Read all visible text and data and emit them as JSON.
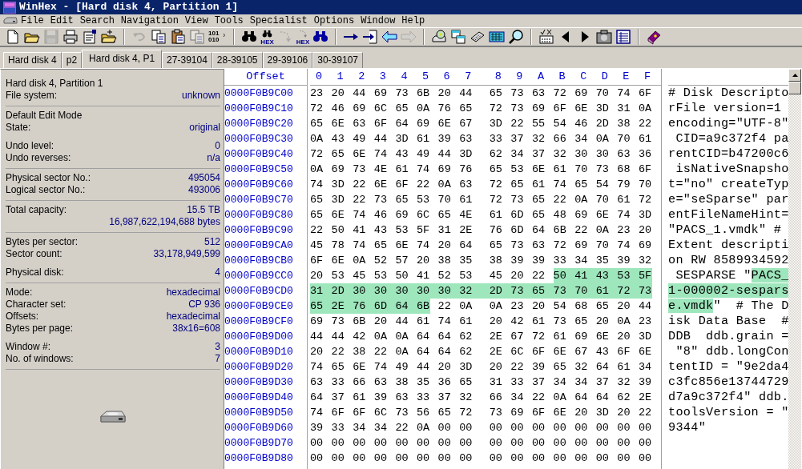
{
  "window": {
    "title": "WinHex - [Hard disk 4, Partition 1]"
  },
  "menu": [
    "File",
    "Edit",
    "Search",
    "Navigation",
    "View",
    "Tools",
    "Specialist",
    "Options",
    "Window",
    "Help"
  ],
  "toolbar": [
    [
      {
        "kind": "new",
        "disabled": false
      },
      {
        "kind": "open",
        "disabled": false
      },
      {
        "kind": "save",
        "disabled": true
      },
      {
        "kind": "print",
        "disabled": false
      },
      {
        "kind": "properties",
        "disabled": false
      },
      {
        "kind": "open-special",
        "disabled": false
      }
    ],
    [
      {
        "kind": "undo",
        "disabled": true
      },
      {
        "kind": "copy",
        "disabled": false
      },
      {
        "kind": "paste",
        "disabled": false
      },
      {
        "kind": "copy",
        "disabled": true
      },
      {
        "kind": "convert",
        "disabled": false,
        "caption": [
          "101",
          "010"
        ]
      }
    ],
    [
      {
        "kind": "find",
        "disabled": false
      },
      {
        "kind": "find",
        "disabled": false,
        "caption": [
          "HEX"
        ]
      },
      {
        "kind": "replace",
        "disabled": true
      },
      {
        "kind": "replace",
        "disabled": false,
        "caption": [
          "HEX"
        ]
      },
      {
        "kind": "find-blue",
        "disabled": false
      }
    ],
    [
      {
        "kind": "goto",
        "disabled": false
      },
      {
        "kind": "goto-page",
        "disabled": false
      },
      {
        "kind": "back",
        "disabled": false
      },
      {
        "kind": "forward",
        "disabled": true
      }
    ],
    [
      {
        "kind": "disk",
        "disabled": false
      },
      {
        "kind": "windows",
        "disabled": false
      },
      {
        "kind": "ram",
        "disabled": false
      },
      {
        "kind": "grid",
        "disabled": false
      },
      {
        "kind": "magnifier",
        "disabled": false
      }
    ],
    [
      {
        "kind": "checks",
        "disabled": false
      },
      {
        "kind": "prev",
        "disabled": false
      },
      {
        "kind": "next",
        "disabled": false
      },
      {
        "kind": "camera",
        "disabled": false
      },
      {
        "kind": "table",
        "disabled": false
      }
    ],
    [
      {
        "kind": "book",
        "disabled": false
      }
    ]
  ],
  "tabs": [
    {
      "label": "Hard disk 4",
      "selected": false
    },
    {
      "label": "p2",
      "selected": false
    },
    {
      "label": "Hard disk 4, P1",
      "selected": true
    },
    {
      "label": "27-39104",
      "selected": false
    },
    {
      "label": "28-39105",
      "selected": false
    },
    {
      "label": "29-39106",
      "selected": false
    },
    {
      "label": "30-39107",
      "selected": false
    }
  ],
  "info_panel": {
    "sections": [
      {
        "groups": [
          [
            {
              "label": "Hard disk 4, Partition 1"
            },
            {
              "label": "File system:",
              "value": "unknown"
            }
          ]
        ]
      },
      {
        "groups": [
          [
            {
              "label": "Default Edit Mode"
            },
            {
              "label": "State:",
              "value": "original"
            }
          ],
          [
            {
              "label": "Undo level:",
              "value": "0"
            },
            {
              "label": "Undo reverses:",
              "value": "n/a"
            }
          ]
        ]
      },
      {
        "groups": [
          [
            {
              "label": "Physical sector No.:",
              "value": "495054"
            },
            {
              "label": "Logical sector No.:",
              "value": "493006"
            }
          ]
        ]
      },
      {
        "groups": [
          [
            {
              "label": "Total capacity:",
              "value": "15.5 TB"
            },
            {
              "value": "16,987,622,194,688 bytes"
            }
          ]
        ]
      },
      {
        "groups": [
          [
            {
              "label": "Bytes per sector:",
              "value": "512"
            },
            {
              "label": "Sector count:",
              "value": "33,178,949,599"
            }
          ],
          [
            {
              "label": "Physical disk:",
              "value": "4"
            }
          ]
        ]
      },
      {
        "groups": [
          [
            {
              "label": "Mode:",
              "value": "hexadecimal"
            },
            {
              "label": "Character set:",
              "value": "CP 936"
            },
            {
              "label": "Offsets:",
              "value": "hexadecimal"
            },
            {
              "label": "Bytes per page:",
              "value": "38x16=608"
            }
          ],
          [
            {
              "label": "Window #:",
              "value": "3"
            },
            {
              "label": "No. of windows:",
              "value": "7"
            }
          ]
        ]
      }
    ]
  },
  "hex_view": {
    "offset_header": "Offset",
    "column_headers": [
      "0",
      "1",
      "2",
      "3",
      "4",
      "5",
      "6",
      "7",
      "8",
      "9",
      "A",
      "B",
      "C",
      "D",
      "E",
      "F"
    ],
    "rows": [
      {
        "offset": "0000F0B9C00",
        "hex": [
          {
            "bytes": "23 20 44 69 73 6B 20 44 65 73 63 72 69 70 74 6F",
            "selected": false
          }
        ],
        "text": [
          {
            "chars": "# Disk Descripto",
            "selected": false
          }
        ]
      },
      {
        "offset": "0000F0B9C10",
        "hex": [
          {
            "bytes": "72 46 69 6C 65 0A 76 65 72 73 69 6F 6E 3D 31 0A",
            "selected": false
          }
        ],
        "text": [
          {
            "chars": "rFile version=1",
            "selected": false
          }
        ]
      },
      {
        "offset": "0000F0B9C20",
        "hex": [
          {
            "bytes": "65 6E 63 6F 64 69 6E 67 3D 22 55 54 46 2D 38 22",
            "selected": false
          }
        ],
        "text": [
          {
            "chars": "encoding=\"UTF-8\"",
            "selected": false
          }
        ]
      },
      {
        "offset": "0000F0B9C30",
        "hex": [
          {
            "bytes": "0A 43 49 44 3D 61 39 63 33 37 32 66 34 0A 70 61",
            "selected": false
          }
        ],
        "text": [
          {
            "chars": " CID=a9c372f4 pa",
            "selected": false
          }
        ]
      },
      {
        "offset": "0000F0B9C40",
        "hex": [
          {
            "bytes": "72 65 6E 74 43 49 44 3D 62 34 37 32 30 30 63 36",
            "selected": false
          }
        ],
        "text": [
          {
            "chars": "rentCID=b47200c6",
            "selected": false
          }
        ]
      },
      {
        "offset": "0000F0B9C50",
        "hex": [
          {
            "bytes": "0A 69 73 4E 61 74 69 76 65 53 6E 61 70 73 68 6F",
            "selected": false
          }
        ],
        "text": [
          {
            "chars": " isNativeSnapsho",
            "selected": false
          }
        ]
      },
      {
        "offset": "0000F0B9C60",
        "hex": [
          {
            "bytes": "74 3D 22 6E 6F 22 0A 63 72 65 61 74 65 54 79 70",
            "selected": false
          }
        ],
        "text": [
          {
            "chars": "t=\"no\" createTyp",
            "selected": false
          }
        ]
      },
      {
        "offset": "0000F0B9C70",
        "hex": [
          {
            "bytes": "65 3D 22 73 65 53 70 61 72 73 65 22 0A 70 61 72",
            "selected": false
          }
        ],
        "text": [
          {
            "chars": "e=\"seSparse\" par",
            "selected": false
          }
        ]
      },
      {
        "offset": "0000F0B9C80",
        "hex": [
          {
            "bytes": "65 6E 74 46 69 6C 65 4E 61 6D 65 48 69 6E 74 3D",
            "selected": false
          }
        ],
        "text": [
          {
            "chars": "entFileNameHint=",
            "selected": false
          }
        ]
      },
      {
        "offset": "0000F0B9C90",
        "hex": [
          {
            "bytes": "22 50 41 43 53 5F 31 2E 76 6D 64 6B 22 0A 23 20",
            "selected": false
          }
        ],
        "text": [
          {
            "chars": "\"PACS_1.vmdk\" #",
            "selected": false
          }
        ]
      },
      {
        "offset": "0000F0B9CA0",
        "hex": [
          {
            "bytes": "45 78 74 65 6E 74 20 64 65 73 63 72 69 70 74 69",
            "selected": false
          }
        ],
        "text": [
          {
            "chars": "Extent descripti",
            "selected": false
          }
        ]
      },
      {
        "offset": "0000F0B9CB0",
        "hex": [
          {
            "bytes": "6F 6E 0A 52 57 20 38 35 38 39 39 33 34 35 39 32",
            "selected": false
          }
        ],
        "text": [
          {
            "chars": "on RW 8589934592",
            "selected": false
          }
        ]
      },
      {
        "offset": "0000F0B9CC0",
        "hex": [
          {
            "bytes": "20 53 45 53 50 41 52 53 45 20 22",
            "selected": false
          },
          {
            "bytes": "50 41 43 53 5F",
            "selected": true
          }
        ],
        "text": [
          {
            "chars": " SESPARSE \"",
            "selected": false
          },
          {
            "chars": "PACS_",
            "selected": true
          }
        ]
      },
      {
        "offset": "0000F0B9CD0",
        "hex": [
          {
            "bytes": "31 2D 30 30 30 30 30 32 2D 73 65 73 70 61 72 73",
            "selected": true
          }
        ],
        "text": [
          {
            "chars": "1-000002-sespars",
            "selected": true
          }
        ]
      },
      {
        "offset": "0000F0B9CE0",
        "hex": [
          {
            "bytes": "65 2E 76 6D 64 6B",
            "selected": true
          },
          {
            "bytes": "22 0A 0A 23 20 54 68 65 20 44",
            "selected": false
          }
        ],
        "text": [
          {
            "chars": "e.vmdk",
            "selected": true
          },
          {
            "chars": "\"  # The D",
            "selected": false
          }
        ]
      },
      {
        "offset": "0000F0B9CF0",
        "hex": [
          {
            "bytes": "69 73 6B 20 44 61 74 61 20 42 61 73 65 20 0A 23",
            "selected": false
          }
        ],
        "text": [
          {
            "chars": "isk Data Base  #",
            "selected": false
          }
        ]
      },
      {
        "offset": "0000F0B9D00",
        "hex": [
          {
            "bytes": "44 44 42 0A 0A 64 64 62 2E 67 72 61 69 6E 20 3D",
            "selected": false
          }
        ],
        "text": [
          {
            "chars": "DDB  ddb.grain =",
            "selected": false
          }
        ]
      },
      {
        "offset": "0000F0B9D10",
        "hex": [
          {
            "bytes": "20 22 38 22 0A 64 64 62 2E 6C 6F 6E 67 43 6F 6E",
            "selected": false
          }
        ],
        "text": [
          {
            "chars": " \"8\" ddb.longCon",
            "selected": false
          }
        ]
      },
      {
        "offset": "0000F0B9D20",
        "hex": [
          {
            "bytes": "74 65 6E 74 49 44 20 3D 20 22 39 65 32 64 61 34",
            "selected": false
          }
        ],
        "text": [
          {
            "chars": "tentID = \"9e2da4",
            "selected": false
          }
        ]
      },
      {
        "offset": "0000F0B9D30",
        "hex": [
          {
            "bytes": "63 33 66 63 38 35 36 65 31 33 37 34 34 37 32 39",
            "selected": false
          }
        ],
        "text": [
          {
            "chars": "c3fc856e13744729",
            "selected": false
          }
        ]
      },
      {
        "offset": "0000F0B9D40",
        "hex": [
          {
            "bytes": "64 37 61 39 63 33 37 32 66 34 22 0A 64 64 62 2E",
            "selected": false
          }
        ],
        "text": [
          {
            "chars": "d7a9c372f4\" ddb.",
            "selected": false
          }
        ]
      },
      {
        "offset": "0000F0B9D50",
        "hex": [
          {
            "bytes": "74 6F 6F 6C 73 56 65 72 73 69 6F 6E 20 3D 20 22",
            "selected": false
          }
        ],
        "text": [
          {
            "chars": "toolsVersion = \"",
            "selected": false
          }
        ]
      },
      {
        "offset": "0000F0B9D60",
        "hex": [
          {
            "bytes": "39 33 34 34 22 0A 00 00 00 00 00 00 00 00 00 00",
            "selected": false
          }
        ],
        "text": [
          {
            "chars": "9344\"",
            "selected": false
          }
        ]
      },
      {
        "offset": "0000F0B9D70",
        "hex": [
          {
            "bytes": "00 00 00 00 00 00 00 00 00 00 00 00 00 00 00 00",
            "selected": false
          }
        ]
      },
      {
        "offset": "0000F0B9D80",
        "hex": [
          {
            "bytes": "00 00 00 00 00 00 00 00 00 00 00 00 00 00 00 00",
            "selected": false
          }
        ]
      }
    ]
  }
}
